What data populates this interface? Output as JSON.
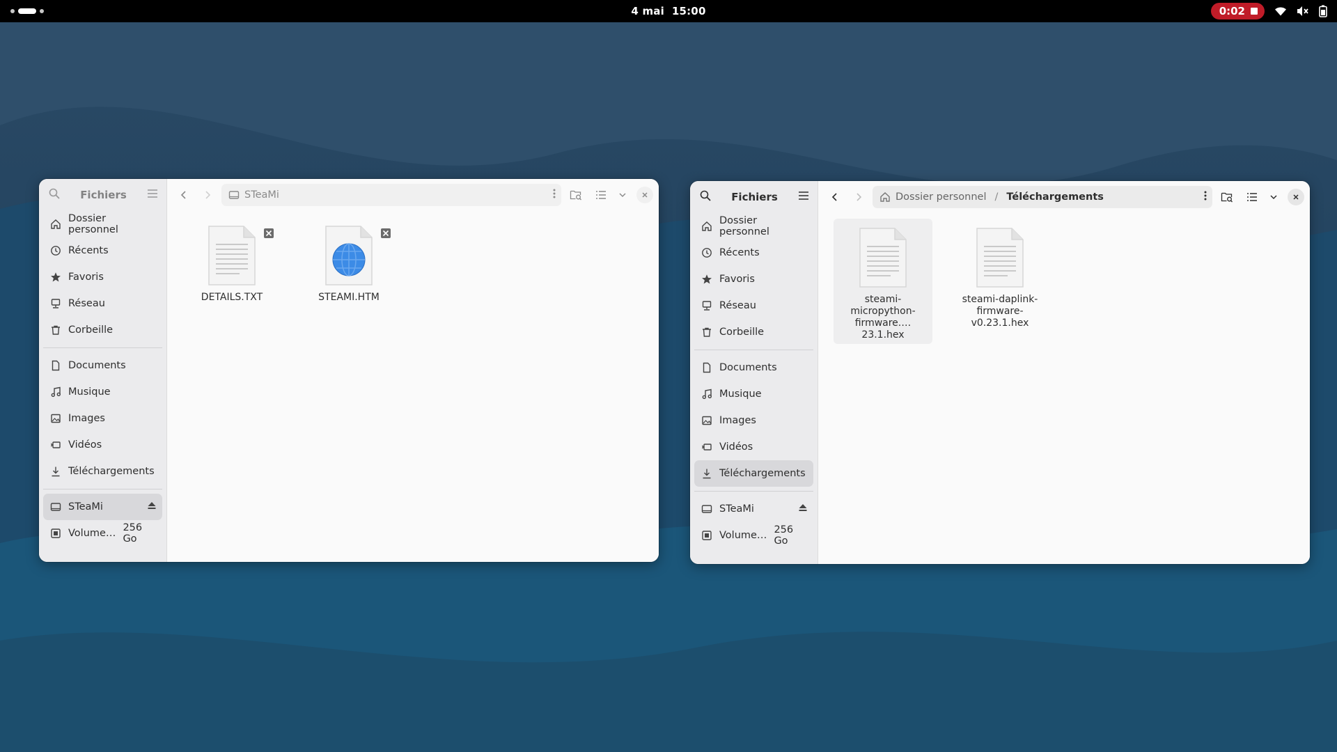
{
  "topbar": {
    "date": "4 mai",
    "time": "15:00",
    "recording_time": "0:02"
  },
  "left_window": {
    "app_title": "Fichiers",
    "path_current": "STeaMi",
    "sidebar": {
      "places": [
        {
          "label": "Dossier personnel",
          "icon": "home-icon"
        },
        {
          "label": "Récents",
          "icon": "clock-icon"
        },
        {
          "label": "Favoris",
          "icon": "star-icon"
        },
        {
          "label": "Réseau",
          "icon": "network-icon"
        },
        {
          "label": "Corbeille",
          "icon": "trash-icon"
        }
      ],
      "bookmarks": [
        {
          "label": "Documents",
          "icon": "document-icon"
        },
        {
          "label": "Musique",
          "icon": "music-icon"
        },
        {
          "label": "Images",
          "icon": "image-icon"
        },
        {
          "label": "Vidéos",
          "icon": "video-icon"
        },
        {
          "label": "Téléchargements",
          "icon": "download-icon"
        }
      ],
      "devices": [
        {
          "label": "STeaMi",
          "icon": "drive-icon",
          "eject": true,
          "selected": true
        },
        {
          "label": "Volume…",
          "size": "256 Go",
          "icon": "disk-icon"
        }
      ]
    },
    "files": [
      {
        "name": "DETAILS.TXT",
        "type": "text",
        "readonly": true
      },
      {
        "name": "STEAMI.HTM",
        "type": "html",
        "readonly": true
      }
    ]
  },
  "right_window": {
    "app_title": "Fichiers",
    "path_home": "Dossier personnel",
    "path_current": "Téléchargements",
    "sidebar": {
      "places": [
        {
          "label": "Dossier personnel",
          "icon": "home-icon"
        },
        {
          "label": "Récents",
          "icon": "clock-icon"
        },
        {
          "label": "Favoris",
          "icon": "star-icon"
        },
        {
          "label": "Réseau",
          "icon": "network-icon"
        },
        {
          "label": "Corbeille",
          "icon": "trash-icon"
        }
      ],
      "bookmarks": [
        {
          "label": "Documents",
          "icon": "document-icon"
        },
        {
          "label": "Musique",
          "icon": "music-icon"
        },
        {
          "label": "Images",
          "icon": "image-icon"
        },
        {
          "label": "Vidéos",
          "icon": "video-icon"
        },
        {
          "label": "Téléchargements",
          "icon": "download-icon",
          "selected": true
        }
      ],
      "devices": [
        {
          "label": "STeaMi",
          "icon": "drive-icon",
          "eject": true
        },
        {
          "label": "Volume…",
          "size": "256 Go",
          "icon": "disk-icon"
        }
      ]
    },
    "files": [
      {
        "name_lines": [
          "steami-",
          "micropython-",
          "firmware.…23.1.hex"
        ],
        "type": "text"
      },
      {
        "name_lines": [
          "steami-daplink-",
          "firmware-",
          "v0.23.1.hex"
        ],
        "type": "text"
      }
    ]
  },
  "colors": {
    "recording": "#c01c28",
    "wallpaper": "#1b4563",
    "window_bg": "#fafafa",
    "sidebar_bg": "#ebebed",
    "html_icon_blue": "#3c8be6"
  }
}
